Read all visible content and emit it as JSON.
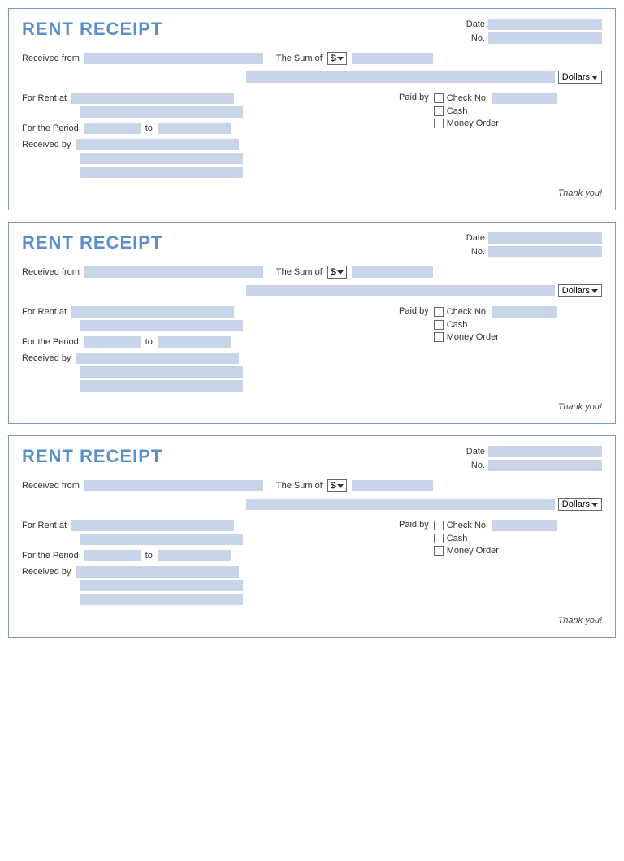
{
  "receipts": [
    {
      "id": 1,
      "title": "RENT RECEIPT",
      "labels": {
        "date": "Date",
        "no": "No.",
        "received_from": "Received from",
        "the_sum_of": "The Sum of",
        "dollar_sign": "$",
        "dollars": "Dollars",
        "for_rent_at": "For Rent at",
        "for_the_period": "For the Period",
        "to": "to",
        "received_by": "Received by",
        "paid_by": "Paid by",
        "check_no": "Check No.",
        "cash": "Cash",
        "money_order": "Money Order",
        "thank_you": "Thank you!"
      }
    },
    {
      "id": 2,
      "title": "RENT RECEIPT",
      "labels": {
        "date": "Date",
        "no": "No.",
        "received_from": "Received from",
        "the_sum_of": "The Sum of",
        "dollar_sign": "$",
        "dollars": "Dollars",
        "for_rent_at": "For Rent at",
        "for_the_period": "For the Period",
        "to": "to",
        "received_by": "Received by",
        "paid_by": "Paid by",
        "check_no": "Check No.",
        "cash": "Cash",
        "money_order": "Money Order",
        "thank_you": "Thank you!"
      }
    },
    {
      "id": 3,
      "title": "RENT RECEIPT",
      "labels": {
        "date": "Date",
        "no": "No.",
        "received_from": "Received from",
        "the_sum_of": "The Sum of",
        "dollar_sign": "$",
        "dollars": "Dollars",
        "for_rent_at": "For Rent at",
        "for_the_period": "For the Period",
        "to": "to",
        "received_by": "Received by",
        "paid_by": "Paid by",
        "check_no": "Check No.",
        "cash": "Cash",
        "money_order": "Money Order",
        "thank_you": "Thank you!"
      }
    }
  ]
}
